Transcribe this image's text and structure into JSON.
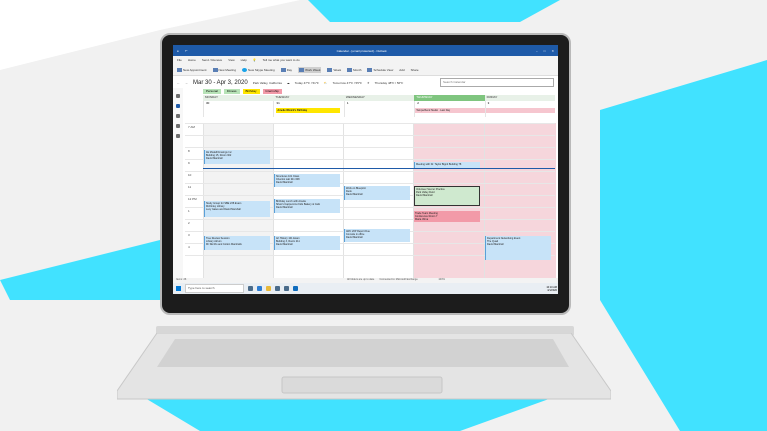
{
  "colors": {
    "accent": "#1e5aa8",
    "cyan": "#3ee0ff",
    "today": "#7fc57f",
    "pink": "#f6d6dc"
  },
  "window": {
    "title": "Calendar - [email protected] - Outlook",
    "search_hint": "Tell me what you want to do"
  },
  "menu": [
    "File",
    "Home",
    "Send / Receive",
    "View",
    "Help"
  ],
  "ribbon": {
    "new_appointment": "New Appointment",
    "new_meeting": "New Meeting",
    "skype": "New Skype Meeting",
    "day": "Day",
    "work_week": "Work Week",
    "week": "Week",
    "month": "Month",
    "schedule": "Schedule View",
    "add": "Add",
    "share": "Share"
  },
  "nav": {
    "range": "Mar 30 - Apr 3, 2020",
    "location": "Park Valley, California",
    "today_label": "Today",
    "today_temp": "47°F / 51°F",
    "tomorrow_label": "Tomorrow",
    "tomorrow_temp": "47°F / 55°F",
    "thursday_label": "Thursday",
    "thursday_temp": "48°F / 56°F",
    "search_placeholder": "Search Calendar"
  },
  "categories": [
    {
      "label": "Personal",
      "color": "#b7e3b7"
    },
    {
      "label": "Fitness",
      "color": "#b7e3b7"
    },
    {
      "label": "Birthday",
      "color": "#ffe600"
    },
    {
      "label": "Internship",
      "color": "#f29aa8"
    }
  ],
  "days": [
    {
      "name": "MONDAY",
      "num": "30"
    },
    {
      "name": "TUESDAY",
      "num": "31"
    },
    {
      "name": "WEDNESDAY",
      "num": "1"
    },
    {
      "name": "THURSDAY",
      "num": "2"
    },
    {
      "name": "FRIDAY",
      "num": "3"
    }
  ],
  "hours": [
    "7 AM",
    "8",
    "9",
    "10",
    "11",
    "12 PM",
    "1",
    "2",
    "3",
    "4"
  ],
  "allday": {
    "birthday": "Amelie Winick's Birthday",
    "friday_event": "Tampa Bend Studio",
    "friday_note": "Last Day"
  },
  "events": {
    "mon1": "1E Modell/Cravings Inc\nBuilding 15, Room 302\nDavid Marshall",
    "mon2": "Study Group for SBE 238 Exam\nMcKinley Library\nLucy Gates and David Marshall",
    "mon3": "Tree Review Session\nLibrary Atrium\nMr SE Rio and Cotton Marshalls",
    "tue1": "Structures 101 Class\nChemist Lab Rm 308\nDavid Marshall",
    "tue2": "Birthday Lunch with Amelie\nSilvio's Cappuccino Kids Bakery & Café\nDavid Marshall",
    "tue3": "Art History 101 Exam\nBuilding 3, Room 211\nDavid Marshall",
    "wed1": "Work on Blueprint\nDesk\nDavid Marshall",
    "wed2": "ARC 20P Report Due\nConsole in office\nDavid Marshall",
    "thu1": "Meeting with Dr. Taylor Bignit Building 78",
    "thu2": "Volunteer Soccer Practice\nPark Valley Field\nDavid Marshall",
    "thu3": "Trade Team Meeting\nConference Room 7\nMaria Vilma",
    "fri1": "Department Networking Event\nThe Quad\nDavid Marshall"
  },
  "status": {
    "items": "Items: 26",
    "sync": "All folders are up to date.",
    "connected": "Connected to: Microsoft Exchange",
    "zoom": "100%"
  },
  "taskbar": {
    "search": "Type here to search",
    "time": "10:10 AM",
    "date": "4/1/2020"
  }
}
